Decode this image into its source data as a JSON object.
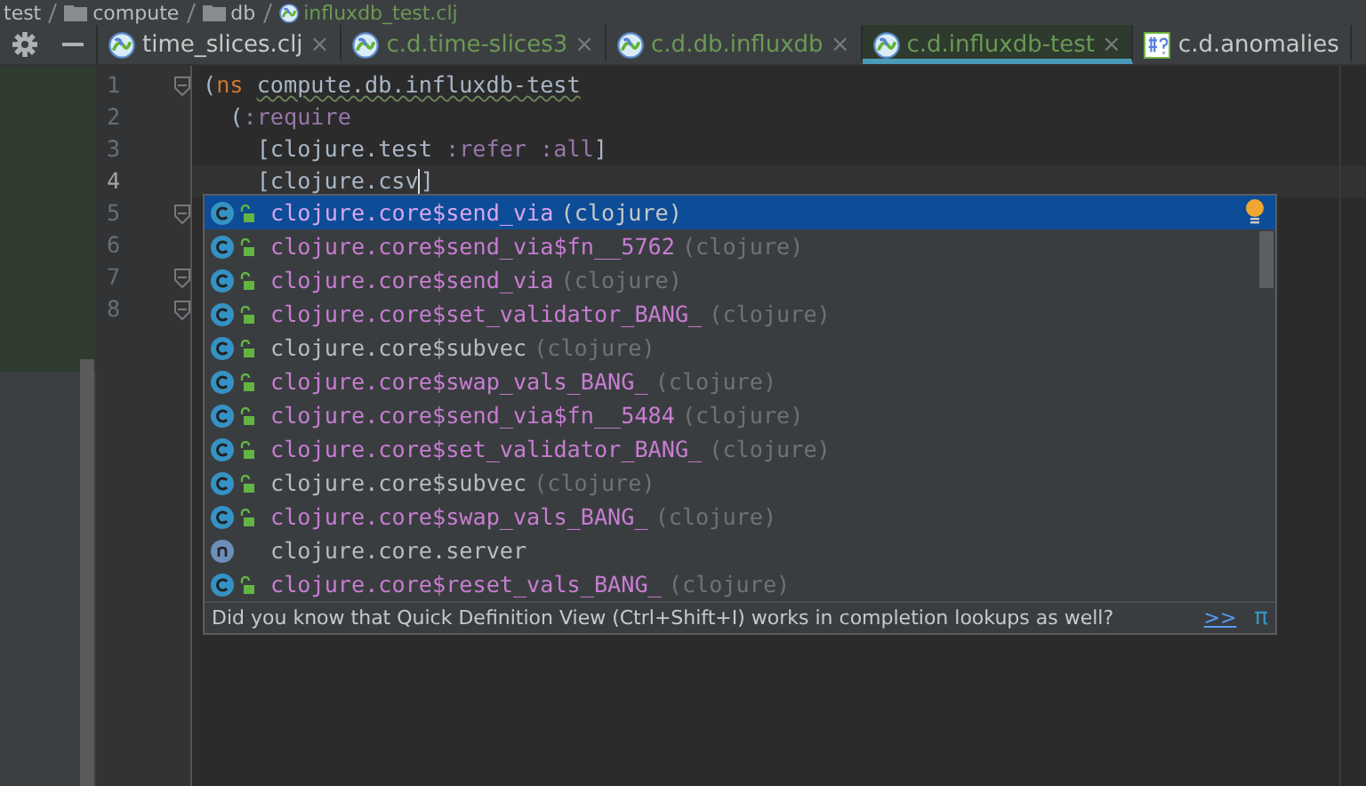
{
  "breadcrumb": [
    {
      "label": "test",
      "kind": "text"
    },
    {
      "label": "compute",
      "kind": "folder"
    },
    {
      "label": "db",
      "kind": "folder"
    },
    {
      "label": "influxdb_test.clj",
      "kind": "clojure"
    }
  ],
  "tabs": [
    {
      "label": "time_slices.clj",
      "kind": "clojure",
      "color": "#c8c8c8",
      "close": "×",
      "selected": false
    },
    {
      "label": "c.d.time-slices3",
      "kind": "clojure",
      "color": "#6a9955",
      "close": "×",
      "selected": false
    },
    {
      "label": "c.d.db.influxdb",
      "kind": "clojure",
      "color": "#6a9955",
      "close": "×",
      "selected": false
    },
    {
      "label": "c.d.influxdb-test",
      "kind": "clojure",
      "color": "#6a9955",
      "close": "×",
      "selected": true
    },
    {
      "label": "c.d.anomalies",
      "kind": "cljc",
      "color": "#c8c8c8",
      "selected": false
    }
  ],
  "line_numbers": [
    "1",
    "2",
    "3",
    "4",
    "5",
    "6",
    "7",
    "8"
  ],
  "code_lines": [
    {
      "fold": true,
      "tokens": [
        {
          "text": "(",
          "kind": "plain"
        },
        {
          "text": "ns ",
          "kind": "special"
        },
        {
          "text": "compute.db.influxdb-test",
          "kind": "warning"
        }
      ]
    },
    {
      "fold": false,
      "tokens": [
        {
          "text": "  (",
          "kind": "plain"
        },
        {
          "text": ":require",
          "kind": "keyword"
        }
      ]
    },
    {
      "fold": false,
      "tokens": [
        {
          "text": "    [clojure.test ",
          "kind": "plain"
        },
        {
          "text": ":refer :all",
          "kind": "keyword"
        },
        {
          "text": "]",
          "kind": "plain"
        }
      ]
    },
    {
      "fold": false,
      "tokens": [
        {
          "text": "    [clojure.csv",
          "kind": "plain",
          "caret": true
        },
        {
          "text": "]",
          "kind": "plain"
        }
      ]
    },
    {
      "fold": true
    },
    {
      "fold": false
    },
    {
      "fold": true
    },
    {
      "fold": true
    }
  ],
  "completion": {
    "items": [
      {
        "kind": "class",
        "name": "clojure.core$send_via",
        "hint": "(clojure)",
        "matched": true,
        "selected": true
      },
      {
        "kind": "class",
        "name": "clojure.core$send_via$fn__5762",
        "hint": "(clojure)",
        "matched": true,
        "selected": false
      },
      {
        "kind": "class",
        "name": "clojure.core$send_via",
        "hint": "(clojure)",
        "matched": true,
        "selected": false
      },
      {
        "kind": "class",
        "name": "clojure.core$set_validator_BANG_",
        "hint": "(clojure)",
        "matched": true,
        "selected": false
      },
      {
        "kind": "class",
        "name": "clojure.core$subvec",
        "hint": "(clojure)",
        "matched": false,
        "selected": false
      },
      {
        "kind": "class",
        "name": "clojure.core$swap_vals_BANG_",
        "hint": "(clojure)",
        "matched": true,
        "selected": false
      },
      {
        "kind": "class",
        "name": "clojure.core$send_via$fn__5484",
        "hint": "(clojure)",
        "matched": true,
        "selected": false
      },
      {
        "kind": "class",
        "name": "clojure.core$set_validator_BANG_",
        "hint": "(clojure)",
        "matched": true,
        "selected": false
      },
      {
        "kind": "class",
        "name": "clojure.core$subvec",
        "hint": "(clojure)",
        "matched": false,
        "selected": false
      },
      {
        "kind": "class",
        "name": "clojure.core$swap_vals_BANG_",
        "hint": "(clojure)",
        "matched": true,
        "selected": false
      },
      {
        "kind": "namespace",
        "name": "clojure.core.server",
        "matched": false,
        "selected": false
      },
      {
        "kind": "class",
        "name": "clojure.core$reset_vals_BANG_",
        "hint": "(clojure)",
        "matched": true,
        "selected": false
      }
    ],
    "tip": "Did you know that Quick Definition View (Ctrl+Shift+I) works in completion lookups as well?",
    "tip_link": ">>",
    "pi": "π"
  }
}
